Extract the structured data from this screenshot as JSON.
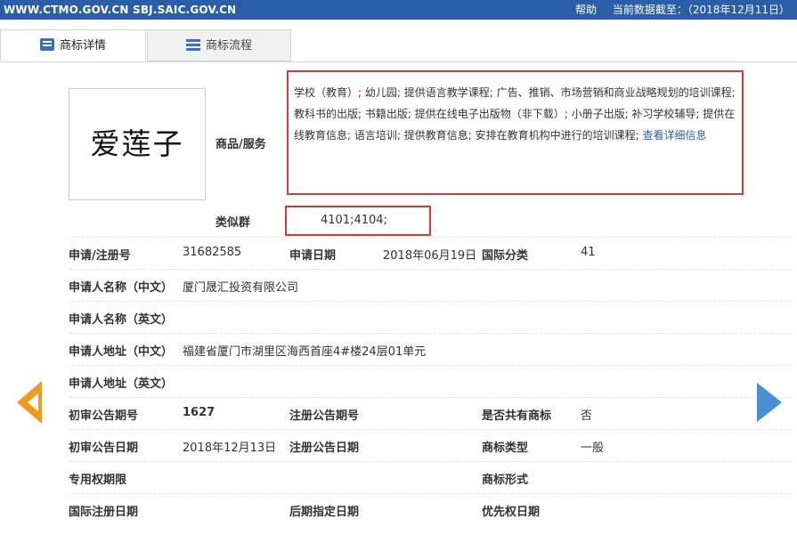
{
  "header": {
    "site": "WWW.CTMO.GOV.CN SBJ.SAIC.GOV.CN",
    "help": "帮助",
    "data_as_of": "当前数据截至：（2018年12月11日）"
  },
  "tabs": [
    {
      "label": "商标详情",
      "icon": "document-icon"
    },
    {
      "label": "商标流程",
      "icon": "list-icon"
    }
  ],
  "trademark": {
    "logo_text": "爱莲子",
    "goods_label": "商品/服务",
    "goods_text": "学校（教育）; 幼儿园; 提供语言教学课程; 广告、推销、市场营销和商业战略规划的培训课程; 教科书的出版; 书籍出版; 提供在线电子出版物（非下载）; 小册子出版; 补习学校辅导; 提供在线教育信息; 语言培训; 提供教育信息; 安排在教育机构中进行的培训课程;",
    "goods_link": "查看详细信息",
    "similar_group_label": "类似群",
    "similar_group": "4101;4104;"
  },
  "fields": {
    "reg_no_label": "申请/注册号",
    "reg_no": "31682585",
    "apply_date_label": "申请日期",
    "apply_date": "2018年06月19日",
    "intl_class_label": "国际分类",
    "intl_class": "41",
    "applicant_cn_label": "申请人名称（中文）",
    "applicant_cn": "厦门晟汇投资有限公司",
    "applicant_en_label": "申请人名称（英文）",
    "applicant_en": "",
    "address_cn_label": "申请人地址（中文）",
    "address_cn": "福建省厦门市湖里区海西首座4#楼24层01单元",
    "address_en_label": "申请人地址（英文）",
    "address_en": "",
    "prelim_issue_label": "初审公告期号",
    "prelim_issue": "1627",
    "reg_issue_label": "注册公告期号",
    "reg_issue": "",
    "shared_label": "是否共有商标",
    "shared": "否",
    "prelim_date_label": "初审公告日期",
    "prelim_date": "2018年12月13日",
    "reg_date_label": "注册公告日期",
    "reg_date": "",
    "type_label": "商标类型",
    "type": "一般",
    "term_label": "专用权期限",
    "term": "",
    "form_label": "商标形式",
    "form": "",
    "intl_reg_date_label": "国际注册日期",
    "intl_reg_date": "",
    "later_date_label": "后期指定日期",
    "later_date": "",
    "priority_date_label": "优先权日期",
    "priority_date": ""
  },
  "colors": {
    "header_bg": "#2a5ea8",
    "highlight": "#d63a3a",
    "prev_arrow": "#f39a1c",
    "next_arrow": "#4a8fd6"
  }
}
